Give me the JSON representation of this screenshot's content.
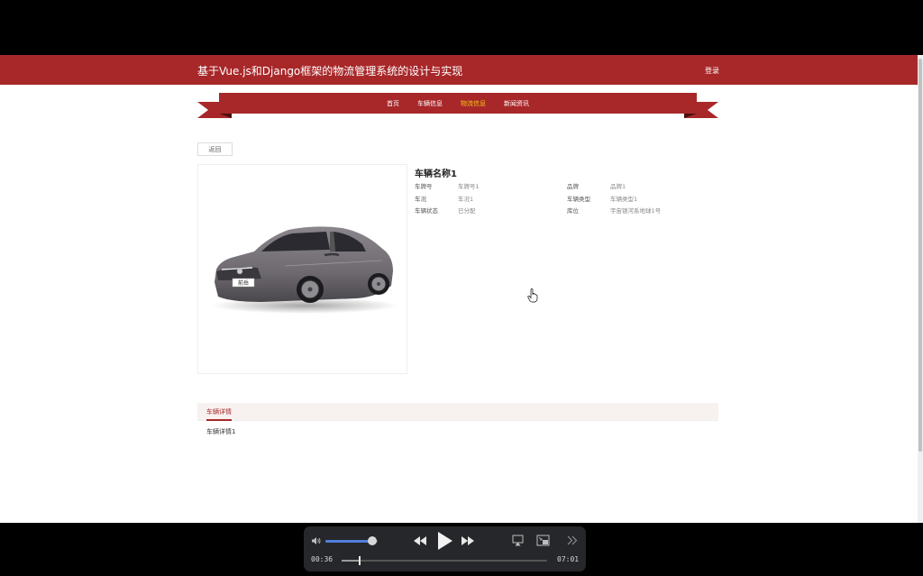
{
  "site": {
    "title": "基于Vue.js和Django框架的物流管理系统的设计与实现",
    "login_label": "登录"
  },
  "nav": {
    "items": [
      {
        "label": "首页",
        "active": false
      },
      {
        "label": "车辆信息",
        "active": false
      },
      {
        "label": "物流信息",
        "active": true
      },
      {
        "label": "新闻资讯",
        "active": false
      }
    ]
  },
  "detail": {
    "back_label": "返回",
    "car_name": "车辆名称1",
    "attributes": [
      {
        "key": "车牌号",
        "value": "车牌号1"
      },
      {
        "key": "品牌",
        "value": "品牌1"
      },
      {
        "key": "车况",
        "value": "车况1"
      },
      {
        "key": "车辆类型",
        "value": "车辆类型1"
      },
      {
        "key": "车辆状态",
        "value": "已分配"
      },
      {
        "key": "库位",
        "value": "宇宙银河系地球1号"
      }
    ],
    "tab_label": "车辆详情",
    "tab_content": "车辆详情1",
    "plate_text": "前岳"
  },
  "player": {
    "current_time": "00:36",
    "total_time": "07:01",
    "volume": 0.9,
    "progress": 0.086
  },
  "colors": {
    "brand": "#a8282a",
    "nav_active": "#f5c518"
  }
}
